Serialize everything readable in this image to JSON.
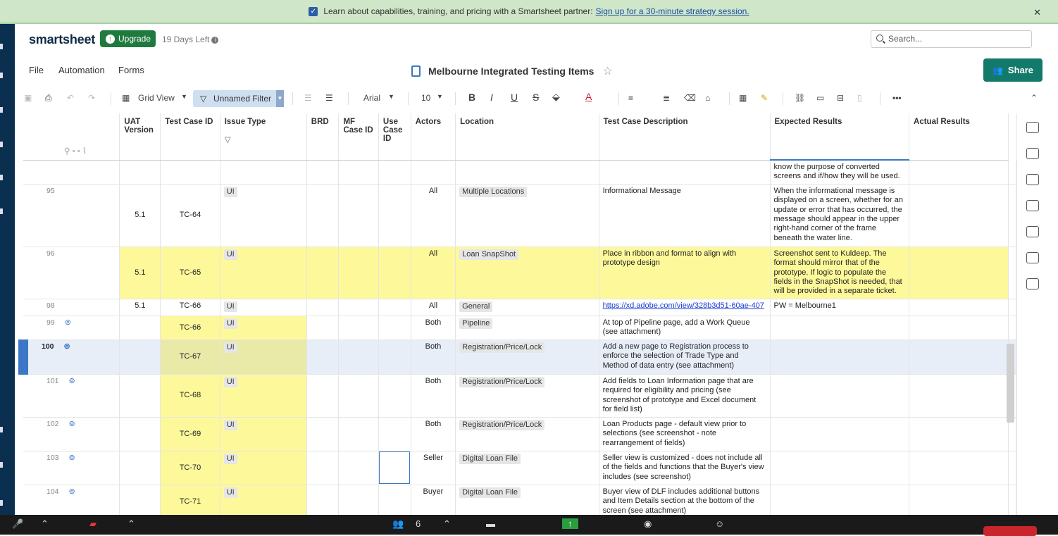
{
  "banner": {
    "text": "Learn about capabilities, training, and pricing with a Smartsheet partner:",
    "link": "Sign up for a 30-minute strategy session.",
    "close": "✕"
  },
  "header": {
    "logo": "smartsheet",
    "upgrade": "Upgrade",
    "trial": "19 Days Left",
    "search_placeholder": "Search...",
    "menu": [
      "File",
      "Automation",
      "Forms"
    ],
    "title": "Melbourne Integrated Testing Items",
    "share": "Share"
  },
  "toolbar": {
    "view": "Grid View",
    "filter": "Unnamed Filter",
    "font": "Arial",
    "size": "10"
  },
  "columns": [
    "UAT Version",
    "Test Case ID",
    "Issue Type",
    "BRD",
    "MF Case ID",
    "Use Case ID",
    "Actors",
    "Location",
    "Test Case Description",
    "Expected Results",
    "Actual Results"
  ],
  "rows": [
    {
      "num": "",
      "uat": "",
      "tc": "",
      "issue": "",
      "actors": "",
      "location": "",
      "desc": "",
      "expected": "know the purpose of converted screens and if/how they will be used.",
      "style": "",
      "attach": false
    },
    {
      "num": "95",
      "uat": "5.1",
      "tc": "TC-64",
      "issue": "UI",
      "actors": "All",
      "location": "Multiple Locations",
      "desc": "Informational Message",
      "expected": "When the informational message is displayed on a screen, whether for an update or error that has occurred, the message should appear in the upper right-hand corner of the frame beneath the water line.",
      "style": "",
      "attach": false
    },
    {
      "num": "96",
      "uat": "5.1",
      "tc": "TC-65",
      "issue": "UI",
      "actors": "All",
      "location": "Loan SnapShot",
      "desc": "Place in ribbon and format to align with prototype design",
      "expected": "Screenshot sent to Kuldeep. The format should mirror that of the prototype. If logic to populate the fields in the SnapShot is needed, that will be provided in a separate ticket.",
      "style": "yellow",
      "attach": false
    },
    {
      "num": "98",
      "uat": "5.1",
      "tc": "TC-66",
      "issue": "UI",
      "actors": "All",
      "location": "General",
      "desc": "https://xd.adobe.com/view/328b3d51-60ae-407",
      "expected": "PW = Melbourne1",
      "style": "",
      "attach": false
    },
    {
      "num": "99",
      "uat": "",
      "tc": "TC-66",
      "issue": "UI",
      "actors": "Both",
      "location": "Pipeline",
      "desc": "At top of Pipeline page, add a Work Queue (see attachment)",
      "expected": "",
      "style": "partial",
      "attach": true
    },
    {
      "num": "100",
      "uat": "",
      "tc": "TC-67",
      "issue": "UI",
      "actors": "Both",
      "location": "Registration/Price/Lock",
      "desc": "Add a new page to Registration process to enforce the selection of Trade Type and Method of data entry (see attachment)",
      "expected": "",
      "style": "selected",
      "attach": true
    },
    {
      "num": "101",
      "uat": "",
      "tc": "TC-68",
      "issue": "UI",
      "actors": "Both",
      "location": "Registration/Price/Lock",
      "desc": "Add fields to Loan Information page that are required for eligibility and pricing (see screenshot of prototype and Excel document for field list)",
      "expected": "",
      "style": "partial",
      "attach": true
    },
    {
      "num": "102",
      "uat": "",
      "tc": "TC-69",
      "issue": "UI",
      "actors": "Both",
      "location": "Registration/Price/Lock",
      "desc": "Loan Products page - default view prior to selections (see screenshot - note rearrangement of fields)",
      "expected": "",
      "style": "partial",
      "attach": true
    },
    {
      "num": "103",
      "uat": "",
      "tc": "TC-70",
      "issue": "UI",
      "actors": "Seller",
      "location": "Digital Loan File",
      "desc": "Seller view is customized - does not include all of the fields and functions that the Buyer's view includes (see screenshot)",
      "expected": "",
      "style": "partial",
      "attach": true
    },
    {
      "num": "104",
      "uat": "",
      "tc": "TC-71",
      "issue": "UI",
      "actors": "Buyer",
      "location": "Digital Loan File",
      "desc": "Buyer view of DLF includes additional buttons and Item Details section at the bottom of the screen (see attachment)",
      "expected": "",
      "style": "partial",
      "attach": true
    }
  ],
  "meeting": {
    "participants": "6"
  }
}
